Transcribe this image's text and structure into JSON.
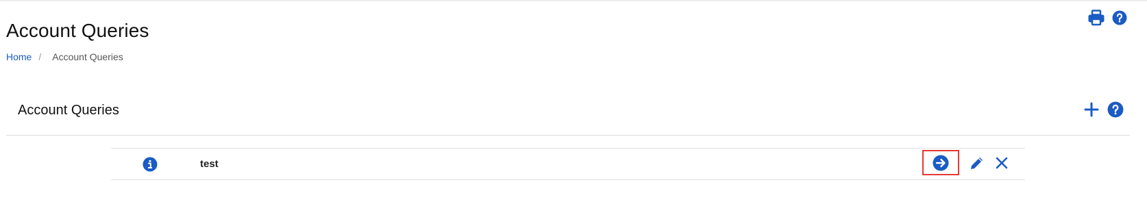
{
  "header": {
    "title": "Account Queries",
    "icons": [
      "printer-icon",
      "help-icon"
    ]
  },
  "breadcrumb": {
    "home": "Home",
    "separator": "/",
    "current": "Account Queries"
  },
  "section": {
    "title": "Account Queries",
    "icons": [
      "plus-icon",
      "help-icon"
    ]
  },
  "queries": [
    {
      "name": "test",
      "icons": [
        "info-icon",
        "run-arrow-icon",
        "edit-pencil-icon",
        "delete-x-icon"
      ]
    }
  ],
  "colors": {
    "accent": "#1a5bc4",
    "highlight": "#e53935",
    "divider": "#dcdcdc"
  }
}
